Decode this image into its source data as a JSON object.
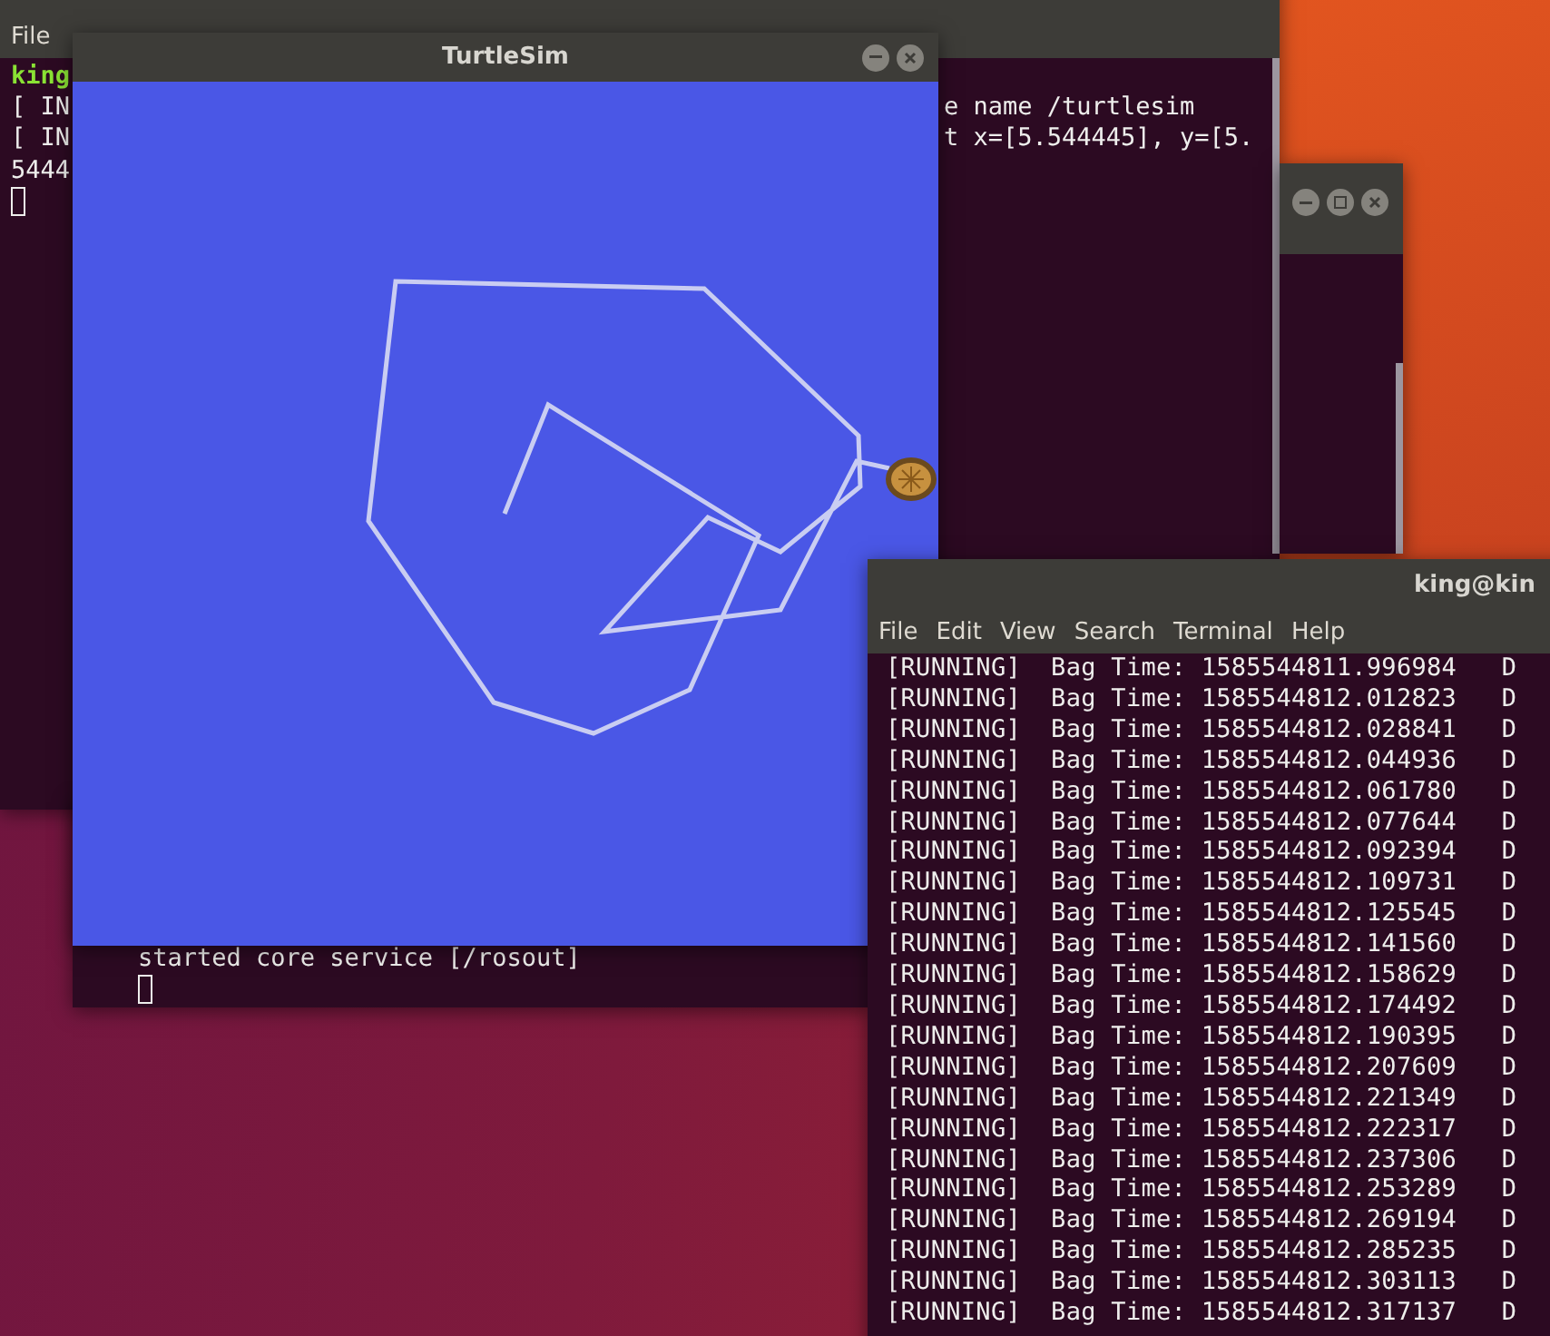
{
  "back_terminal": {
    "menu": [
      "File"
    ],
    "left_lines": [
      {
        "text": "king",
        "kind": "prompt"
      },
      {
        "text": "[ IN",
        "kind": "plain"
      },
      {
        "text": "[ IN",
        "kind": "plain"
      },
      {
        "text": "5444",
        "kind": "plain"
      }
    ],
    "right_lines": [
      "e name /turtlesim",
      "t x=[5.544445], y=[5."
    ]
  },
  "roscore_terminal": {
    "lines": [
      "started core service [/rosout]"
    ]
  },
  "turtlesim": {
    "title": "TurtleSim"
  },
  "bag_terminal": {
    "title": "king@kin",
    "menu": [
      "File",
      "Edit",
      "View",
      "Search",
      "Terminal",
      "Help"
    ],
    "rows": [
      "[RUNNING]  Bag Time: 1585544811.996984   D",
      "[RUNNING]  Bag Time: 1585544812.012823   D",
      "[RUNNING]  Bag Time: 1585544812.028841   D",
      "[RUNNING]  Bag Time: 1585544812.044936   D",
      "[RUNNING]  Bag Time: 1585544812.061780   D",
      "[RUNNING]  Bag Time: 1585544812.077644   D",
      "[RUNNING]  Bag Time: 1585544812.092394   D",
      "[RUNNING]  Bag Time: 1585544812.109731   D",
      "[RUNNING]  Bag Time: 1585544812.125545   D",
      "[RUNNING]  Bag Time: 1585544812.141560   D",
      "[RUNNING]  Bag Time: 1585544812.158629   D",
      "[RUNNING]  Bag Time: 1585544812.174492   D",
      "[RUNNING]  Bag Time: 1585544812.190395   D",
      "[RUNNING]  Bag Time: 1585544812.207609   D",
      "[RUNNING]  Bag Time: 1585544812.221349   D",
      "[RUNNING]  Bag Time: 1585544812.222317   D",
      "[RUNNING]  Bag Time: 1585544812.237306   D",
      "[RUNNING]  Bag Time: 1585544812.253289   D",
      "[RUNNING]  Bag Time: 1585544812.269194   D",
      "[RUNNING]  Bag Time: 1585544812.285235   D",
      "[RUNNING]  Bag Time: 1585544812.303113   D",
      "[RUNNING]  Bag Time: 1585544812.317137   D"
    ]
  }
}
